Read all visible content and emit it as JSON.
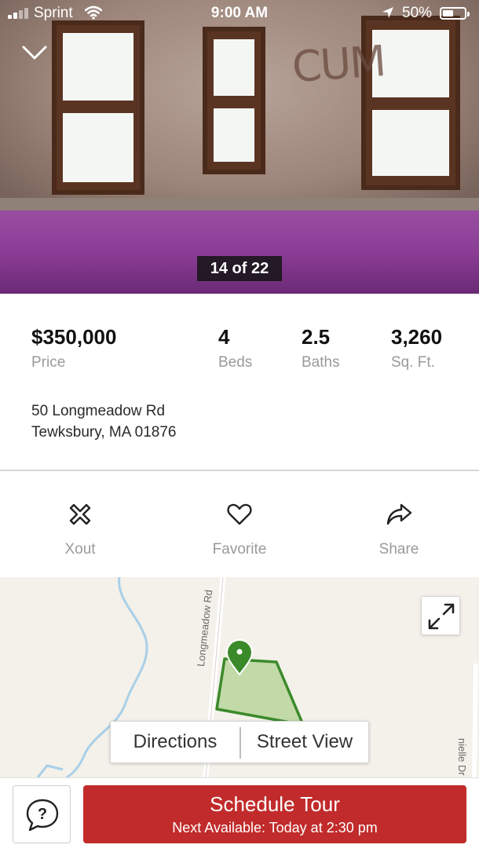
{
  "status_bar": {
    "carrier": "Sprint",
    "time": "9:00 AM",
    "battery_pct": "50%",
    "battery_level": 0.5
  },
  "gallery": {
    "counter": "14 of 22"
  },
  "stats": [
    {
      "value": "$350,000",
      "label": "Price"
    },
    {
      "value": "4",
      "label": "Beds"
    },
    {
      "value": "2.5",
      "label": "Baths"
    },
    {
      "value": "3,260",
      "label": "Sq. Ft."
    }
  ],
  "address": {
    "line1": "50 Longmeadow Rd",
    "line2": "Tewksbury, MA 01876"
  },
  "actions": [
    {
      "label": "Xout",
      "icon": "xout-icon"
    },
    {
      "label": "Favorite",
      "icon": "heart-icon"
    },
    {
      "label": "Share",
      "icon": "share-icon"
    }
  ],
  "map": {
    "road_label": "Longmeadow Rd",
    "road_label_2": "nielle Dr",
    "tabs": [
      "Directions",
      "Street View"
    ],
    "parcel_color": "#3b8a2a",
    "parcel_fill": "#c2d9a8",
    "water_color": "#a9cfe8"
  },
  "footer": {
    "schedule_label": "Schedule Tour",
    "schedule_sub": "Next Available: Today at 2:30 pm",
    "accent": "#c12b2b"
  }
}
